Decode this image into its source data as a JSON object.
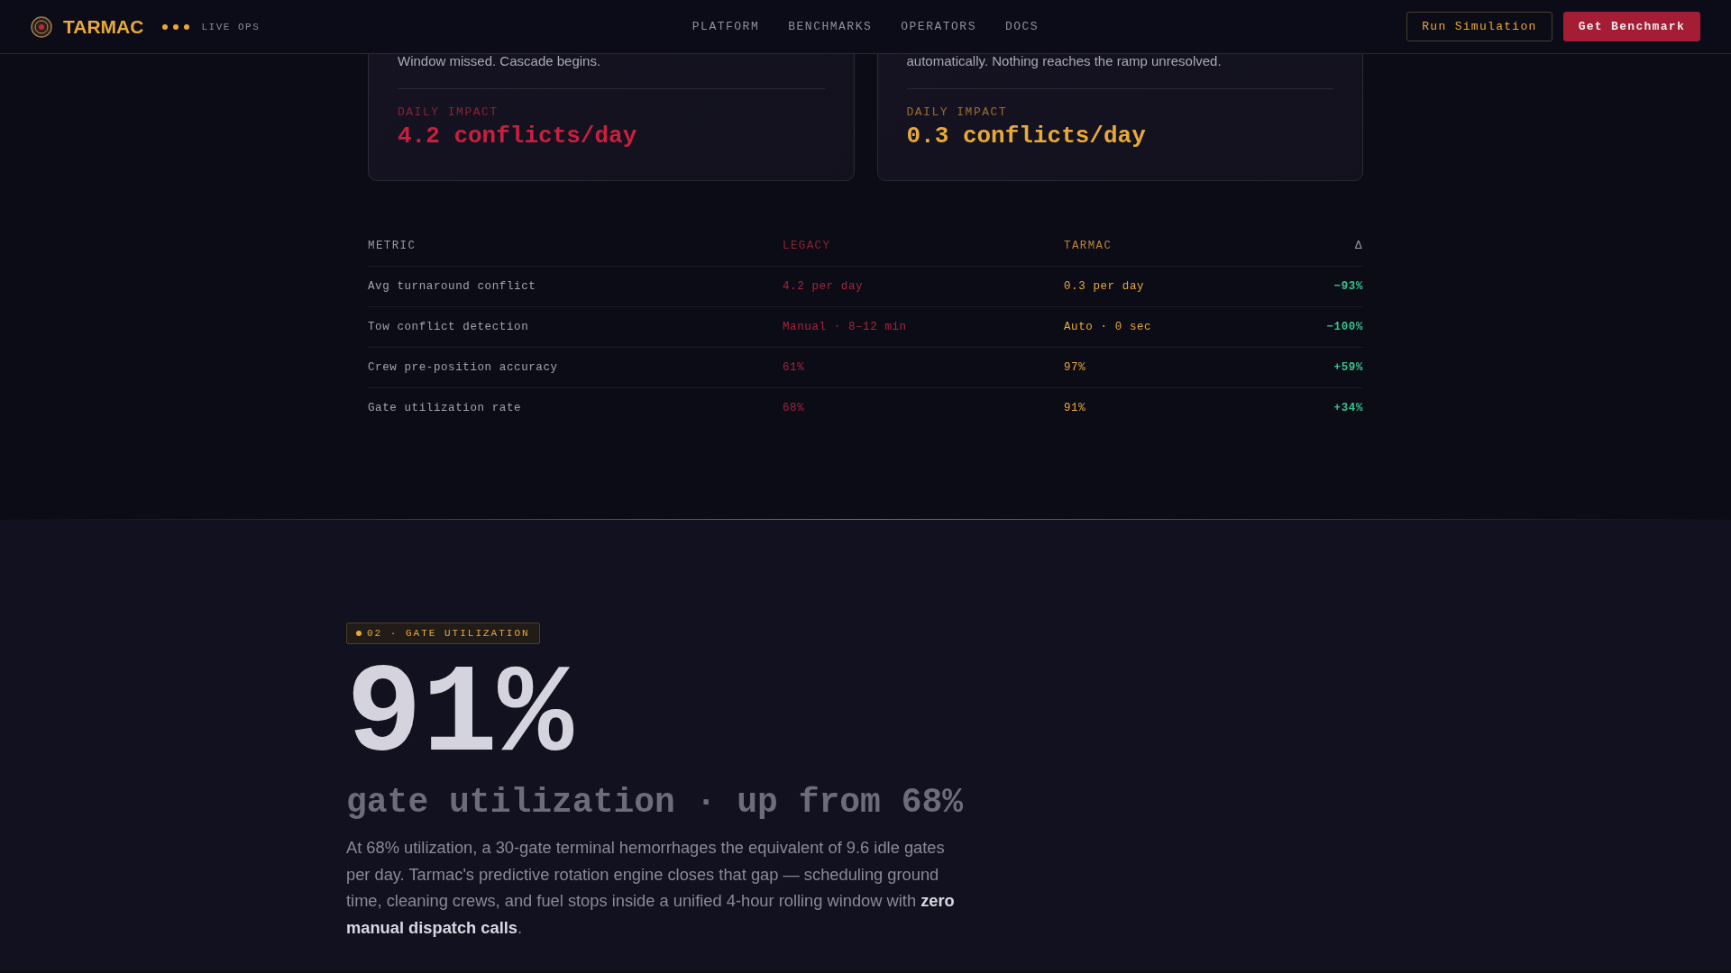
{
  "header": {
    "brand": "TARMAC",
    "status": "LIVE OPS",
    "nav": [
      "PLATFORM",
      "BENCHMARKS",
      "OPERATORS",
      "DOCS"
    ],
    "buttons": [
      {
        "label": "Run Simulation",
        "kind": "outline"
      },
      {
        "label": "Get Benchmark",
        "kind": "primary"
      }
    ]
  },
  "cards": [
    {
      "kind": "legacy",
      "text": "Window missed. Cascade begins.",
      "impact_label": "DAILY IMPACT",
      "impact": "4.2 conflicts/day"
    },
    {
      "kind": "tarmac",
      "text": "automatically. Nothing reaches the ramp unresolved.",
      "impact_label": "DAILY IMPACT",
      "impact": "0.3 conflicts/day"
    }
  ],
  "table": {
    "columns": [
      "METRIC",
      "LEGACY",
      "TARMAC",
      "Δ"
    ],
    "rows": [
      [
        "Avg turnaround conflict",
        "4.2 per day",
        "0.3 per day",
        "−93%"
      ],
      [
        "Tow conflict detection",
        "Manual · 8–12 min",
        "Auto · 0 sec",
        "−100%"
      ],
      [
        "Crew pre-position accuracy",
        "61%",
        "97%",
        "+59%"
      ],
      [
        "Gate utilization rate",
        "68%",
        "91%",
        "+34%"
      ]
    ]
  },
  "section": {
    "badge": "02 · GATE UTILIZATION",
    "headline": "91%",
    "subtitle": "gate utilization · up from 68%",
    "body": "At 68% utilization, a 30-gate terminal hemorrhages the equivalent of 9.6 idle gates per day. Tarmac's predictive rotation engine closes that gap — scheduling ground time, cleaning crews, and fuel stops inside a unified 4-hour rolling window with **zero manual dispatch calls**."
  }
}
